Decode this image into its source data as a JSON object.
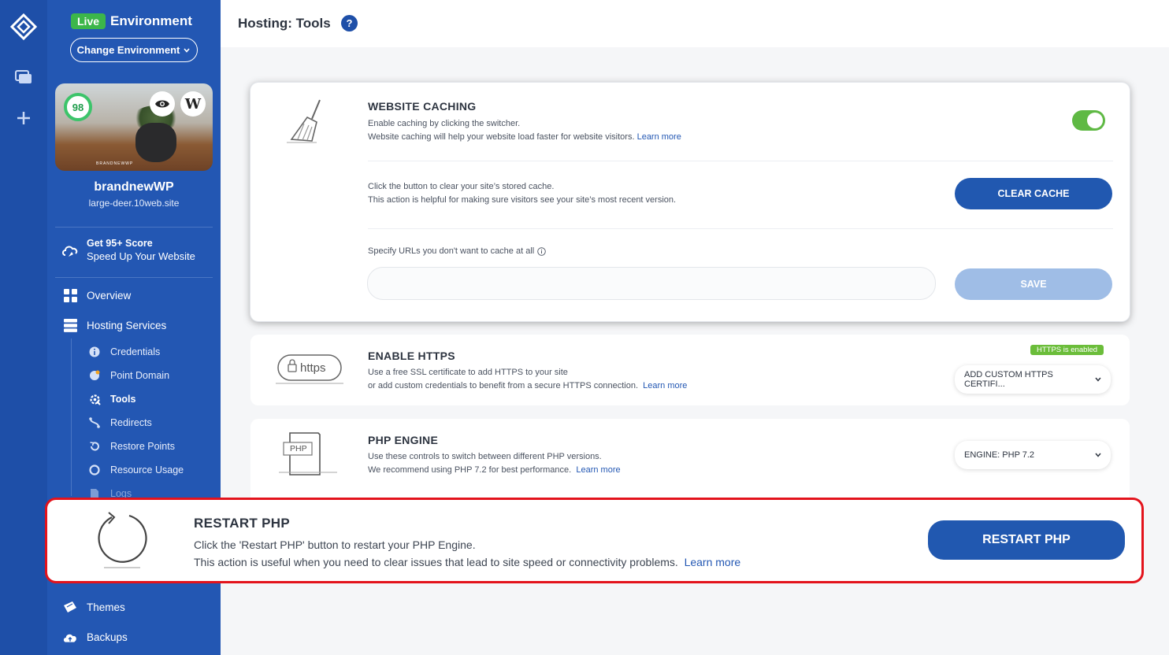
{
  "header": {
    "title": "Hosting: Tools",
    "help_icon": "?"
  },
  "environment": {
    "badge": "Live",
    "label": "Environment",
    "change_button": "Change Environment"
  },
  "site": {
    "score": "98",
    "name": "brandnewWP",
    "url": "large-deer.10web.site",
    "thumb_brand": "BRANDNEWWP"
  },
  "promo": {
    "line1": "Get 95+ Score",
    "line2": "Speed Up Your Website"
  },
  "nav": {
    "overview": "Overview",
    "hosting_services": "Hosting Services",
    "sub": [
      "Credentials",
      "Point Domain",
      "Tools",
      "Redirects",
      "Restore Points",
      "Resource Usage",
      "Logs"
    ],
    "themes": "Themes",
    "backups": "Backups"
  },
  "caching": {
    "title": "WEBSITE CACHING",
    "line1": "Enable caching by clicking the switcher.",
    "line2": "Website caching will help your website load faster for website visitors.",
    "learn": "Learn more",
    "toggle_on": true,
    "clear_line1": "Click the button to clear your site’s stored cache.",
    "clear_line2": "This action is helpful for making sure visitors see your site’s most recent version.",
    "clear_button": "CLEAR CACHE",
    "exclude_label": "Specify URLs you don't want to cache at all",
    "exclude_value": "",
    "save_button": "SAVE"
  },
  "https": {
    "title": "ENABLE HTTPS",
    "line1": "Use a free SSL certificate to add HTTPS to your site",
    "line2": "or add custom credentials to benefit from a secure HTTPS connection.",
    "learn": "Learn more",
    "badge": "HTTPS is enabled",
    "select": "ADD CUSTOM HTTPS CERTIFI...",
    "icon_text": "https"
  },
  "php": {
    "title": "PHP ENGINE",
    "line1": "Use these controls to switch between different PHP versions.",
    "line2": "We recommend using PHP 7.2 for best performance.",
    "learn": "Learn more",
    "select": "ENGINE: PHP 7.2",
    "icon_text": "PHP"
  },
  "restart": {
    "title": "RESTART PHP",
    "line1": "Click the 'Restart PHP' button to restart your PHP Engine.",
    "line2": "This action is useful when you need to clear issues that lead to site speed or connectivity problems.",
    "learn": "Learn more",
    "button": "RESTART PHP"
  },
  "colors": {
    "brand": "#1e4fa8",
    "sidebar": "#2357b3",
    "live": "#3cb64a",
    "highlight": "#e3131c"
  }
}
